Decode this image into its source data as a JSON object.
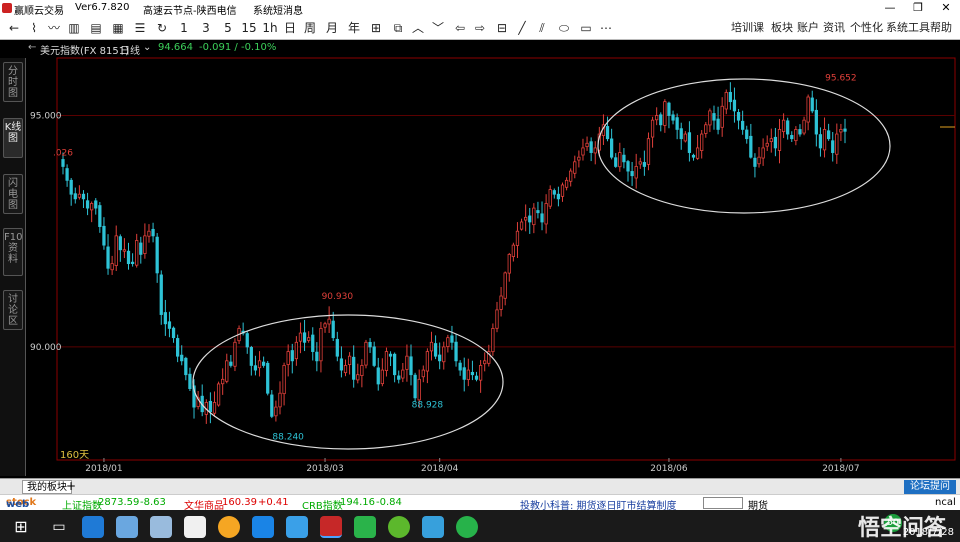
{
  "titlebar": {
    "app_name": "赢顺云交易",
    "version": "Ver6.7.820",
    "server": "高速云节点-陕西电信",
    "news": "系统短消息",
    "minimize": "—",
    "restore": "❐",
    "close": "✕"
  },
  "toolbar": {
    "period_buttons": [
      "1",
      "3",
      "5",
      "15",
      "1h",
      "日",
      "周",
      "月",
      "年"
    ],
    "right_menu": [
      "培训课",
      "板块",
      "账户",
      "资讯",
      "个性化",
      "系统工具",
      "帮助"
    ]
  },
  "info": {
    "symbol": "美元指数(FX 8151)",
    "period": "日线",
    "price": "94.664",
    "change": "-0.091 / -0.10%"
  },
  "lefttabs": [
    "分时图",
    "K线图",
    "闪电图",
    "F10资料",
    "讨论区"
  ],
  "colors": {
    "up": "#e0403a",
    "down": "#2ec3d6",
    "grid": "#5a0000",
    "price_label": "#cccccc",
    "annot_high": "#e0403a",
    "annot_low": "#2ec3d6"
  },
  "chart_data": {
    "type": "candlestick",
    "y_ticks": [
      "95.000",
      "90.000"
    ],
    "y_tick_values": [
      95.0,
      90.0
    ],
    "ylim": [
      87.6,
      96.2
    ],
    "x_labels": [
      "2018/01",
      "2018/03",
      "2018/04",
      "2018/06",
      "2018/07"
    ],
    "x_label_indices": [
      10,
      64,
      92,
      148,
      190
    ],
    "days_label": "160天",
    "annotations": [
      {
        "text": ".026",
        "index": 0,
        "value": 94.03,
        "kind": "high"
      },
      {
        "text": "90.930",
        "index": 67,
        "value": 90.93,
        "kind": "high"
      },
      {
        "text": "88.240",
        "index": 55,
        "value": 88.24,
        "kind": "low"
      },
      {
        "text": "88.928",
        "index": 89,
        "value": 88.93,
        "kind": "low"
      },
      {
        "text": "95.652",
        "index": 190,
        "value": 95.65,
        "kind": "high"
      }
    ],
    "closes": [
      93.9,
      93.6,
      93.3,
      93.2,
      93.3,
      93.2,
      93.0,
      93.1,
      93.0,
      92.6,
      92.2,
      91.7,
      91.8,
      92.4,
      92.1,
      92.1,
      91.8,
      91.8,
      92.3,
      92.0,
      92.4,
      92.5,
      92.4,
      91.6,
      90.7,
      90.5,
      90.4,
      90.2,
      89.8,
      89.7,
      89.4,
      89.1,
      88.7,
      88.9,
      88.6,
      88.8,
      88.6,
      88.8,
      89.2,
      89.3,
      89.7,
      89.6,
      90.1,
      90.4,
      90.3,
      90.0,
      89.6,
      89.5,
      89.7,
      89.6,
      89.0,
      88.5,
      88.7,
      89.0,
      89.6,
      89.9,
      89.7,
      90.1,
      90.3,
      90.1,
      90.2,
      89.9,
      89.7,
      90.4,
      90.5,
      90.6,
      90.2,
      89.8,
      89.5,
      89.6,
      89.8,
      89.3,
      89.4,
      89.6,
      90.1,
      90.0,
      89.6,
      89.2,
      89.5,
      89.9,
      89.8,
      89.4,
      89.3,
      89.5,
      89.8,
      89.4,
      88.9,
      89.3,
      89.5,
      89.9,
      90.1,
      89.8,
      89.7,
      90.0,
      90.2,
      90.1,
      89.7,
      89.5,
      89.3,
      89.5,
      89.4,
      89.3,
      89.6,
      89.7,
      89.9,
      90.4,
      90.8,
      91.1,
      91.6,
      92.0,
      92.2,
      92.5,
      92.7,
      92.8,
      92.7,
      93.0,
      92.9,
      92.7,
      93.1,
      93.4,
      93.3,
      93.2,
      93.5,
      93.6,
      93.8,
      94.0,
      94.1,
      94.3,
      94.4,
      94.2,
      94.3,
      94.6,
      94.8,
      94.5,
      94.1,
      93.9,
      94.2,
      94.0,
      93.8,
      93.7,
      93.9,
      94.0,
      93.9,
      94.5,
      94.9,
      95.0,
      94.8,
      95.3,
      95.0,
      94.9,
      94.7,
      94.5,
      94.6,
      94.2,
      94.1,
      94.3,
      94.6,
      94.8,
      95.1,
      94.9,
      94.7,
      95.2,
      95.5,
      95.3,
      95.1,
      94.9,
      94.7,
      94.5,
      94.1,
      93.9,
      94.1,
      94.3,
      94.4,
      94.5,
      94.3,
      94.7,
      94.9,
      94.6,
      94.5,
      94.7,
      94.6,
      94.9,
      95.4,
      95.1,
      94.6,
      94.3,
      94.7,
      94.5,
      94.2,
      94.6,
      94.7,
      94.66
    ]
  },
  "bottomtabs": {
    "my_board": "我的板块",
    "add": "+",
    "forum": "论坛提问"
  },
  "statusbar": {
    "brand_a": "web",
    "brand_b": "stock",
    "items": [
      {
        "name": "上证指数",
        "value": "2873.59",
        "change": "-8.63",
        "color": "#0a0"
      },
      {
        "name": "文华商品",
        "value": "160.39",
        "change": "+0.41",
        "color": "#d00"
      },
      {
        "name": "CRB指数",
        "value": "194.16",
        "change": "-0.84",
        "color": "#0a0"
      }
    ],
    "ticker": "投教小科普: 期货逐日盯市结算制度",
    "right_btn": "期货",
    "right_text": "ncal"
  },
  "taskbar": {
    "time": "2018/7/28",
    "watermark": "悟空问答",
    "badge": "50"
  }
}
